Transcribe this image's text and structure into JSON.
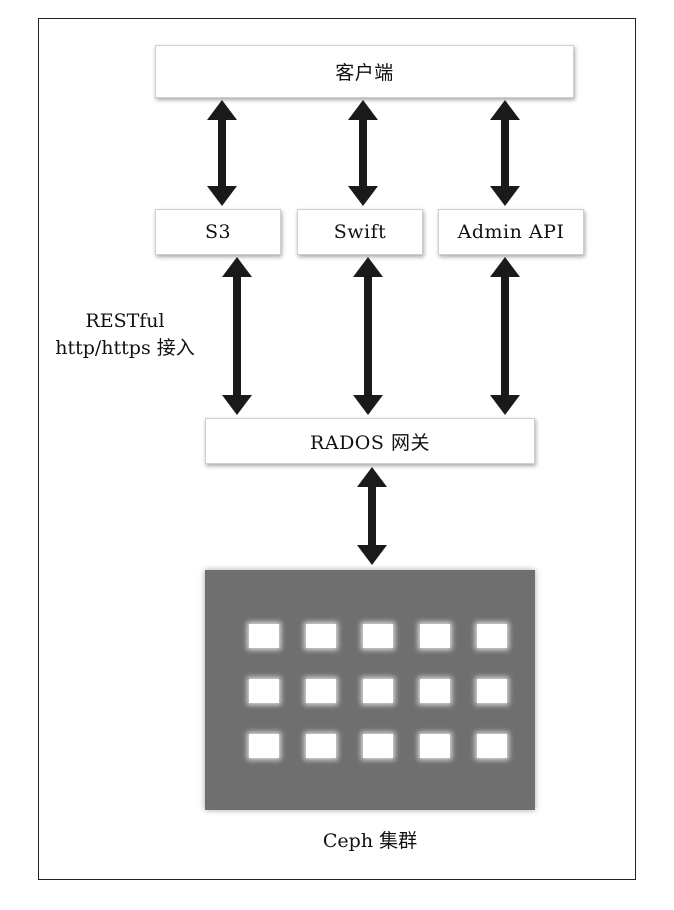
{
  "client": {
    "label": "客户端"
  },
  "apis": [
    {
      "label": "S3"
    },
    {
      "label": "Swift"
    },
    {
      "label": "Admin API"
    }
  ],
  "side_note": {
    "line1": "RESTful",
    "line2": "http/https 接入"
  },
  "gateway": {
    "label": "RADOS 网关"
  },
  "cluster": {
    "label": "Ceph 集群",
    "rows": 3,
    "cols": 5
  },
  "colors": {
    "cluster_fill": "#6f6f6f",
    "arrow": "#1a1a1a",
    "node": "#ffffff"
  }
}
